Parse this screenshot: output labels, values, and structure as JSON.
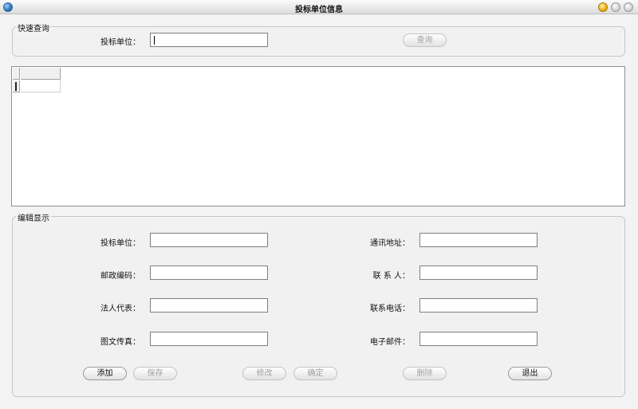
{
  "window": {
    "title": "投标单位信息"
  },
  "quick_search": {
    "group_label": "快速查询",
    "field_label": "投标单位：",
    "field_value": "",
    "search_button": "查询"
  },
  "results_table": {
    "columns": [
      ""
    ],
    "rows": [
      [
        ""
      ]
    ]
  },
  "edit": {
    "group_label": "编辑显示",
    "fields": [
      {
        "label": "投标单位：",
        "value": ""
      },
      {
        "label": "通讯地址：",
        "value": ""
      },
      {
        "label": "邮政编码：",
        "value": ""
      },
      {
        "label": "联 系 人：",
        "value": ""
      },
      {
        "label": "法人代表：",
        "value": ""
      },
      {
        "label": "联系电话：",
        "value": ""
      },
      {
        "label": "图文传真：",
        "value": ""
      },
      {
        "label": "电子邮件：",
        "value": ""
      }
    ],
    "buttons": {
      "add": "添加",
      "save": "保存",
      "modify": "修改",
      "confirm": "确定",
      "delete": "删除",
      "exit": "退出"
    }
  }
}
